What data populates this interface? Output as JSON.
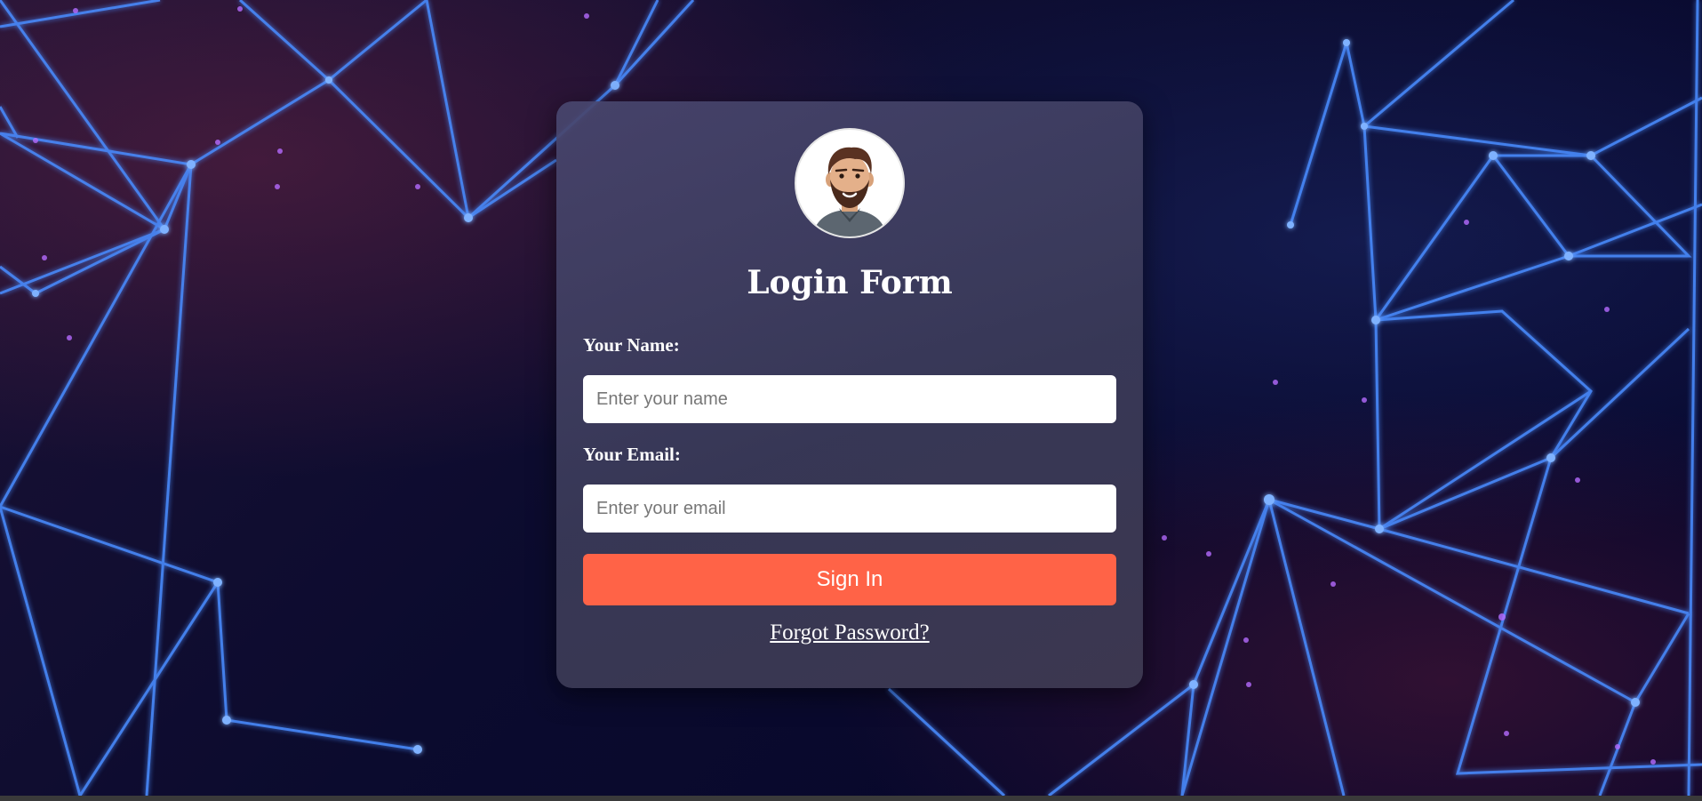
{
  "form": {
    "title": "Login Form",
    "name_label": "Your Name:",
    "name_placeholder": "Enter your name",
    "name_value": "",
    "email_label": "Your Email:",
    "email_placeholder": "Enter your email",
    "email_value": "",
    "signin_label": "Sign In",
    "forgot_label": "Forgot Password?"
  },
  "avatar": {
    "icon": "man-avatar-icon"
  },
  "colors": {
    "accent": "#ff6347",
    "card": "#3e3c5c",
    "background": "#0a0a2a",
    "lines": "#4a90ff"
  }
}
